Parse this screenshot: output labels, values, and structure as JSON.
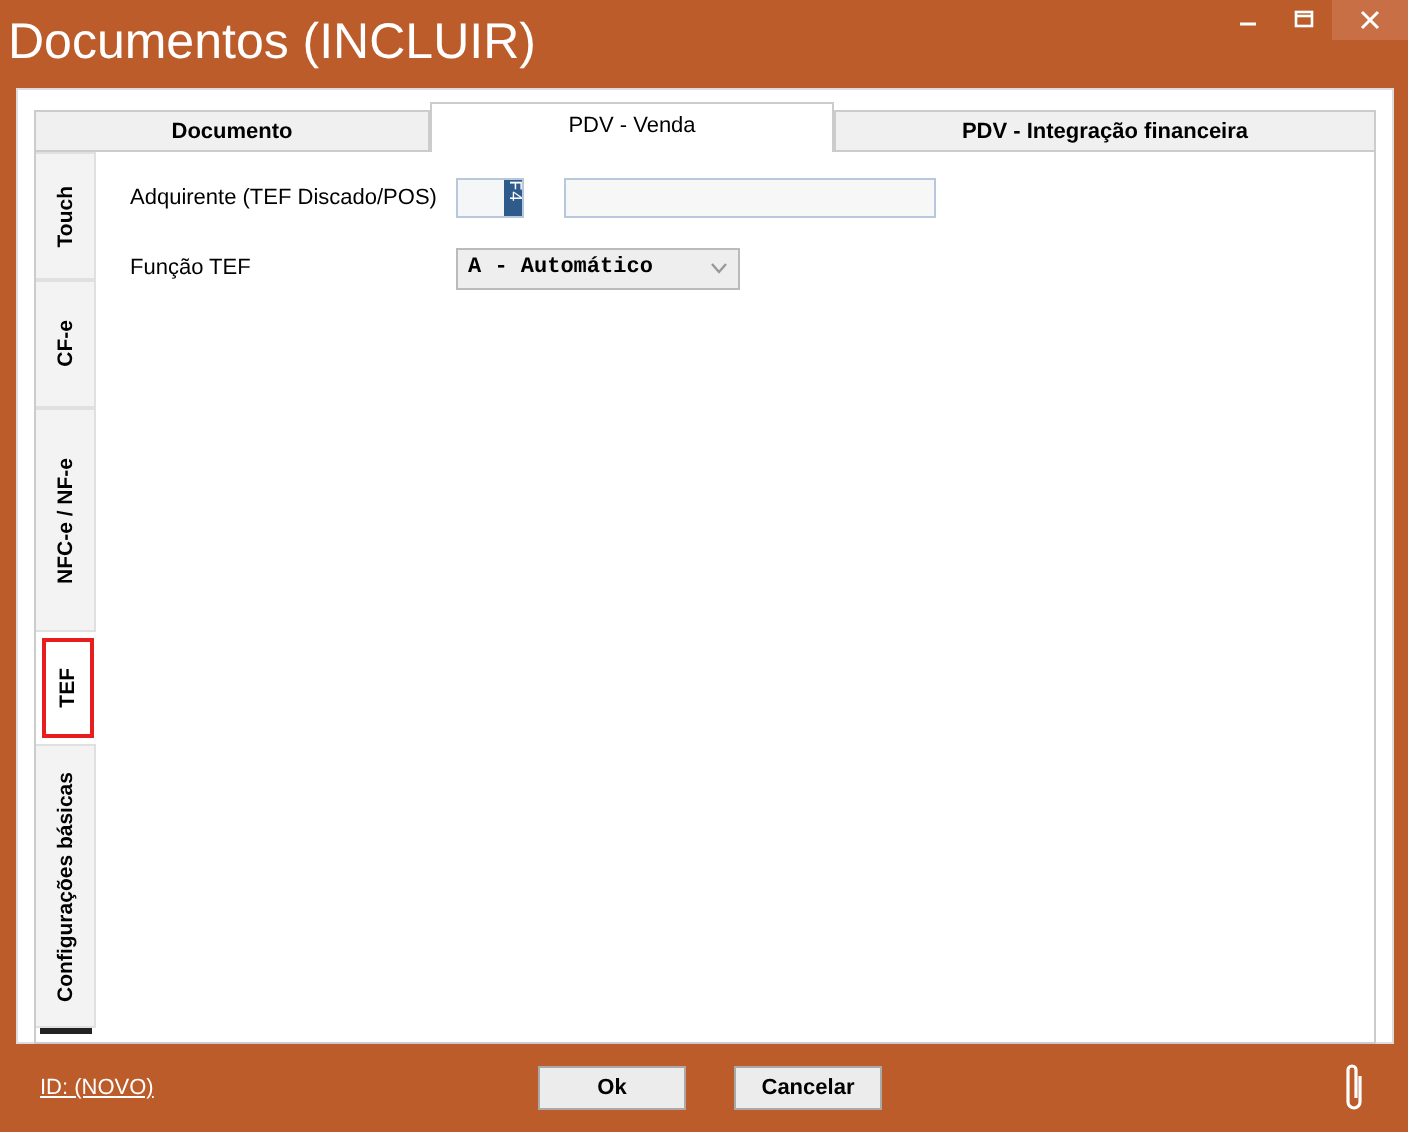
{
  "window": {
    "title": "Documentos (INCLUIR)"
  },
  "tabs": [
    {
      "label": "Documento",
      "selected": false
    },
    {
      "label": "PDV - Venda",
      "selected": true
    },
    {
      "label": "PDV - Integração financeira",
      "selected": false
    }
  ],
  "side_tabs": [
    {
      "label": "Touch",
      "selected": false
    },
    {
      "label": "CF-e",
      "selected": false
    },
    {
      "label": "NFC-e / NF-e",
      "selected": false
    },
    {
      "label": "TEF",
      "selected": true
    },
    {
      "label": "Configurações básicas",
      "selected": false
    }
  ],
  "fields": [
    {
      "label": "Adquirente (TEF Discado/POS)",
      "kind": "lookup",
      "key": "F4"
    },
    {
      "label": "Função TEF",
      "kind": "dropdown",
      "value": "A - Automático"
    }
  ],
  "footer": {
    "id_link": "ID: (NOVO)",
    "buttons": [
      "Ok",
      "Cancelar"
    ]
  }
}
